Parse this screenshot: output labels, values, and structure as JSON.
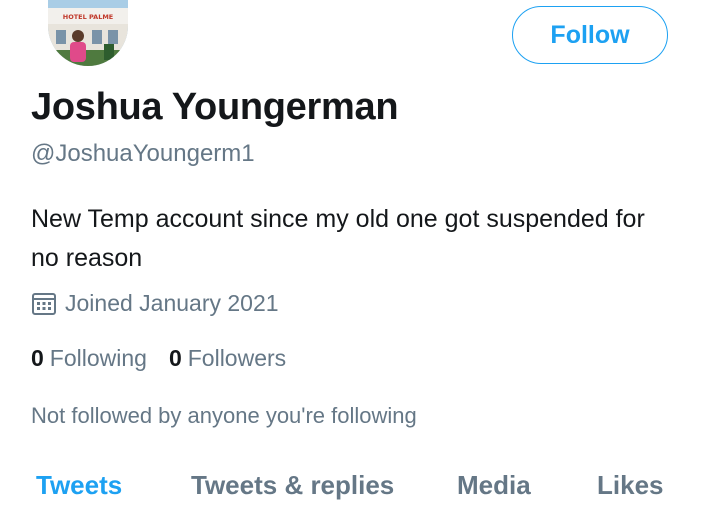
{
  "profile": {
    "name": "Joshua Youngerman",
    "handle": "@JoshuaYoungerm1",
    "bio": "New Temp account since my old one got suspended for no reason",
    "joined": "Joined January 2021",
    "avatar_sign_text": "HOTEL PALME",
    "following_count": "0",
    "following_label": "Following",
    "followers_count": "0",
    "followers_label": "Followers",
    "not_followed_text": "Not followed by anyone you're following"
  },
  "actions": {
    "follow_label": "Follow"
  },
  "tabs": [
    {
      "label": "Tweets",
      "active": true
    },
    {
      "label": "Tweets & replies",
      "active": false
    },
    {
      "label": "Media",
      "active": false
    },
    {
      "label": "Likes",
      "active": false
    }
  ],
  "colors": {
    "accent": "#1da1f2",
    "secondary_text": "#657786",
    "primary_text": "#14171a"
  },
  "icons": {
    "joined": "calendar-icon"
  }
}
